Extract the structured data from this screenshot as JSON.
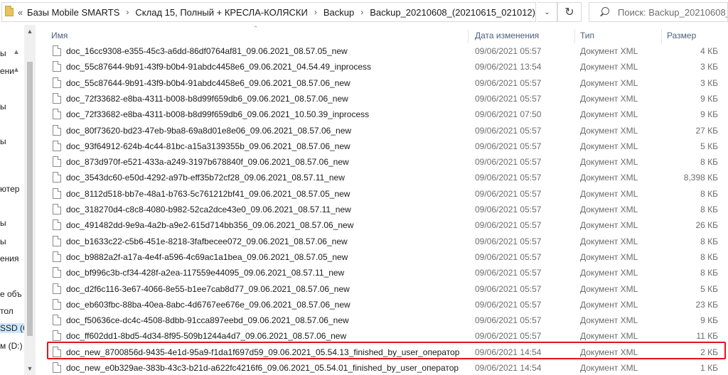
{
  "address_bar": {
    "prefix": "«",
    "breadcrumbs": [
      "Базы Mobile SMARTS",
      "Склад 15, Полный + КРЕСЛА-КОЛЯСКИ",
      "Backup",
      "Backup_20210608_(20210615_021012)"
    ],
    "separator": "›"
  },
  "search": {
    "placeholder": "Поиск: Backup_20210608_(2"
  },
  "nav_pane": {
    "items": [
      "ы",
      "ени",
      "ы",
      "ы",
      "ютер",
      "ы",
      "ы",
      "ения",
      "е объ",
      "тол",
      "SSD (C",
      "м (D:)"
    ]
  },
  "columns": {
    "name": "Имя",
    "date": "Дата изменения",
    "type": "Тип",
    "size": "Размер"
  },
  "files": [
    {
      "name": "doc_16cc9308-e355-45c3-a6dd-86df0764af81_09.06.2021_08.57.05_new",
      "date": "09/06/2021 05:57",
      "type": "Документ XML",
      "size": "4 КБ"
    },
    {
      "name": "doc_55c87644-9b91-43f9-b0b4-91abdc4458e6_09.06.2021_04.54.49_inprocess",
      "date": "09/06/2021 13:54",
      "type": "Документ XML",
      "size": "3 КБ"
    },
    {
      "name": "doc_55c87644-9b91-43f9-b0b4-91abdc4458e6_09.06.2021_08.57.06_new",
      "date": "09/06/2021 05:57",
      "type": "Документ XML",
      "size": "3 КБ"
    },
    {
      "name": "doc_72f33682-e8ba-4311-b008-b8d99f659db6_09.06.2021_08.57.06_new",
      "date": "09/06/2021 05:57",
      "type": "Документ XML",
      "size": "9 КБ"
    },
    {
      "name": "doc_72f33682-e8ba-4311-b008-b8d99f659db6_09.06.2021_10.50.39_inprocess",
      "date": "09/06/2021 07:50",
      "type": "Документ XML",
      "size": "9 КБ"
    },
    {
      "name": "doc_80f73620-bd23-47eb-9ba8-69a8d01e8e06_09.06.2021_08.57.06_new",
      "date": "09/06/2021 05:57",
      "type": "Документ XML",
      "size": "27 КБ"
    },
    {
      "name": "doc_93f64912-624b-4c44-81bc-a15a3139355b_09.06.2021_08.57.06_new",
      "date": "09/06/2021 05:57",
      "type": "Документ XML",
      "size": "5 КБ"
    },
    {
      "name": "doc_873d970f-e521-433a-a249-3197b678840f_09.06.2021_08.57.06_new",
      "date": "09/06/2021 05:57",
      "type": "Документ XML",
      "size": "8 КБ"
    },
    {
      "name": "doc_3543dc60-e50d-4292-a97b-eff35b72cf28_09.06.2021_08.57.11_new",
      "date": "09/06/2021 05:57",
      "type": "Документ XML",
      "size": "8,398 КБ"
    },
    {
      "name": "doc_8112d518-bb7e-48a1-b763-5c761212bf41_09.06.2021_08.57.05_new",
      "date": "09/06/2021 05:57",
      "type": "Документ XML",
      "size": "8 КБ"
    },
    {
      "name": "doc_318270d4-c8c8-4080-b982-52ca2dce43e0_09.06.2021_08.57.11_new",
      "date": "09/06/2021 05:57",
      "type": "Документ XML",
      "size": "8 КБ"
    },
    {
      "name": "doc_491482dd-9e9a-4a2b-a9e2-615d714bb356_09.06.2021_08.57.06_new",
      "date": "09/06/2021 05:57",
      "type": "Документ XML",
      "size": "26 КБ"
    },
    {
      "name": "doc_b1633c22-c5b6-451e-8218-3fafbecee072_09.06.2021_08.57.06_new",
      "date": "09/06/2021 05:57",
      "type": "Документ XML",
      "size": "8 КБ"
    },
    {
      "name": "doc_b9882a2f-a17a-4e4f-a596-4c69ac1a1bea_09.06.2021_08.57.05_new",
      "date": "09/06/2021 05:57",
      "type": "Документ XML",
      "size": "8 КБ"
    },
    {
      "name": "doc_bf996c3b-cf34-428f-a2ea-117559e44095_09.06.2021_08.57.11_new",
      "date": "09/06/2021 05:57",
      "type": "Документ XML",
      "size": "8 КБ"
    },
    {
      "name": "doc_d2f6c116-3e67-4066-8e55-b1ee7cab8d77_09.06.2021_08.57.06_new",
      "date": "09/06/2021 05:57",
      "type": "Документ XML",
      "size": "5 КБ"
    },
    {
      "name": "doc_eb603fbc-88ba-40ea-8abc-4d6767ee676e_09.06.2021_08.57.06_new",
      "date": "09/06/2021 05:57",
      "type": "Документ XML",
      "size": "23 КБ"
    },
    {
      "name": "doc_f50636ce-dc4c-4508-8dbb-91cca897eebd_09.06.2021_08.57.06_new",
      "date": "09/06/2021 05:57",
      "type": "Документ XML",
      "size": "9 КБ"
    },
    {
      "name": "doc_ff602dd1-8bd5-4d34-8f95-509b1244a4d7_09.06.2021_08.57.06_new",
      "date": "09/06/2021 05:57",
      "type": "Документ XML",
      "size": "11 КБ"
    },
    {
      "name": "doc_new_8700856d-9435-4e1d-95a9-f1da1f697d59_09.06.2021_05.54.13_finished_by_user_оператор",
      "date": "09/06/2021 14:54",
      "type": "Документ XML",
      "size": "2 КБ",
      "highlighted": true
    },
    {
      "name": "doc_new_e0b329ae-383b-43c3-b21d-a622fc4216f6_09.06.2021_05.54.01_finished_by_user_оператор",
      "date": "09/06/2021 14:54",
      "type": "Документ XML",
      "size": "1 КБ"
    }
  ],
  "highlight_color": "#e3141b"
}
